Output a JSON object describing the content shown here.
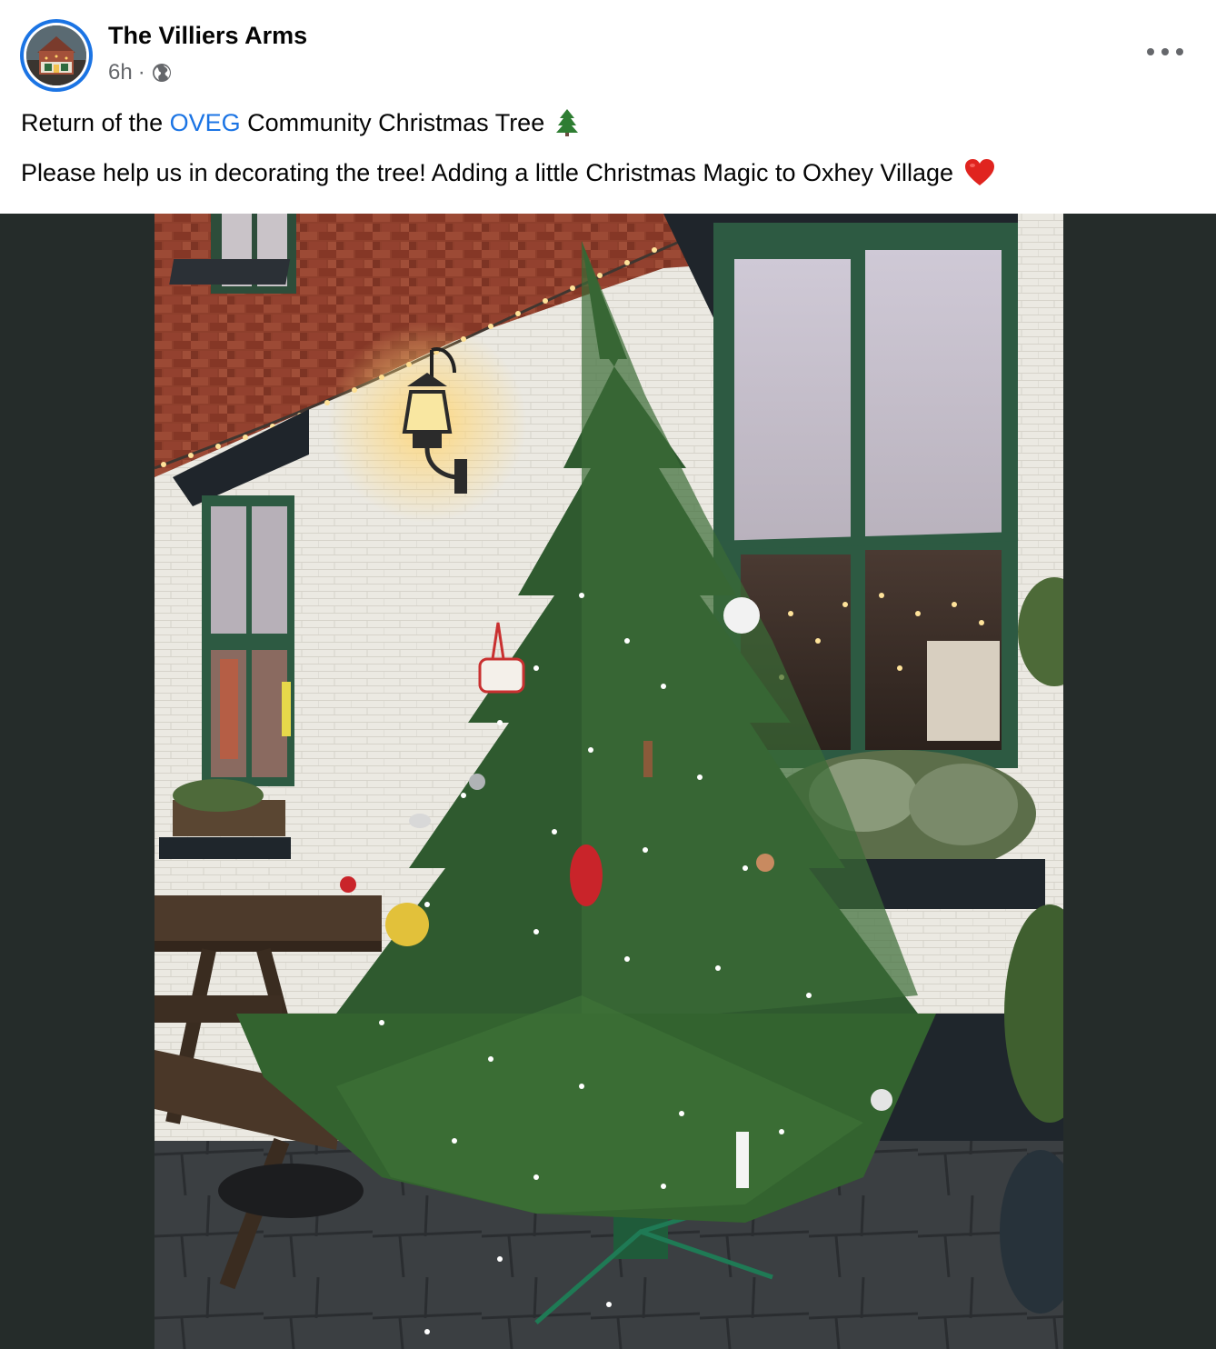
{
  "post": {
    "page_name": "The Villiers Arms",
    "time": "6h",
    "separator": "·",
    "privacy_icon": "globe-icon",
    "more_icon": "more-options-icon",
    "line1": {
      "before": "Return of the ",
      "hashtag": "OVEG",
      "after": " Community Christmas Tree",
      "emoji": "christmas-tree-emoji"
    },
    "line2": {
      "text": "Please help us in decorating the tree! Adding a little Christmas Magic to Oxhey Village",
      "emoji": "red-heart-emoji"
    },
    "photo_subject": "Christmas tree outside The Villiers Arms pub"
  },
  "colors": {
    "link": "#1b74e4",
    "secondary_text": "#65676b",
    "photo_letterbox": "#252c2a"
  }
}
